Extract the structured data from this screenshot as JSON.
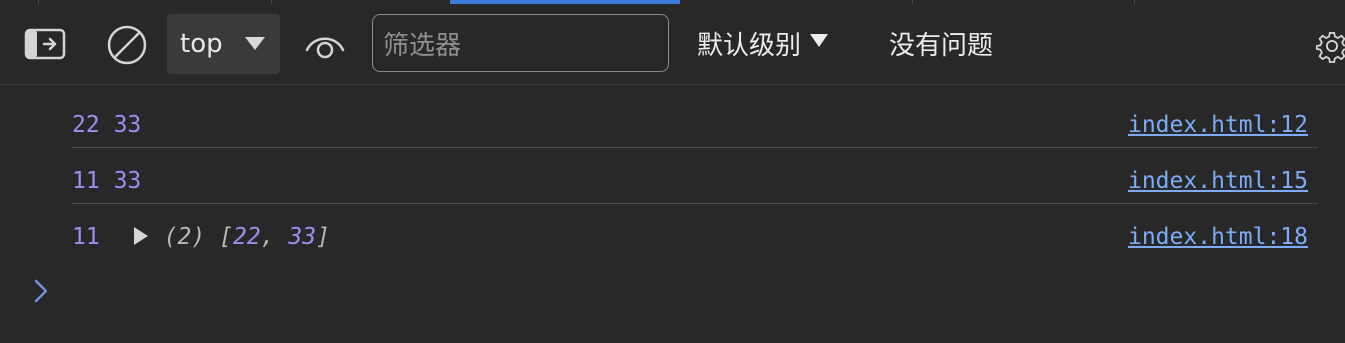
{
  "toolbar": {
    "context": "top",
    "filter_placeholder": "筛选器",
    "levels_label": "默认级别",
    "issues_label": "没有问题"
  },
  "icons": {
    "sidebar": "sidebar-toggle-icon",
    "clear": "clear-console-icon",
    "context_caret": "caret-down-icon",
    "live_expression": "eye-icon",
    "levels_caret": "caret-down-icon",
    "settings": "gear-icon",
    "expand": "triangle-right-icon",
    "prompt": "chevron-right-icon"
  },
  "colors": {
    "background": "#282828",
    "number": "#9d8ff2",
    "link": "#7cacf8",
    "accent_tab": "#3b7ad9"
  },
  "console": {
    "messages": [
      {
        "a": "22",
        "b": "33",
        "source": "index.html:12"
      },
      {
        "a": "11",
        "b": "33",
        "source": "index.html:15"
      },
      {
        "a": "11",
        "array_len": "(2)",
        "open": "[",
        "v1": "22",
        "sep": ", ",
        "v2": "33",
        "close": "]",
        "source": "index.html:18"
      }
    ]
  }
}
